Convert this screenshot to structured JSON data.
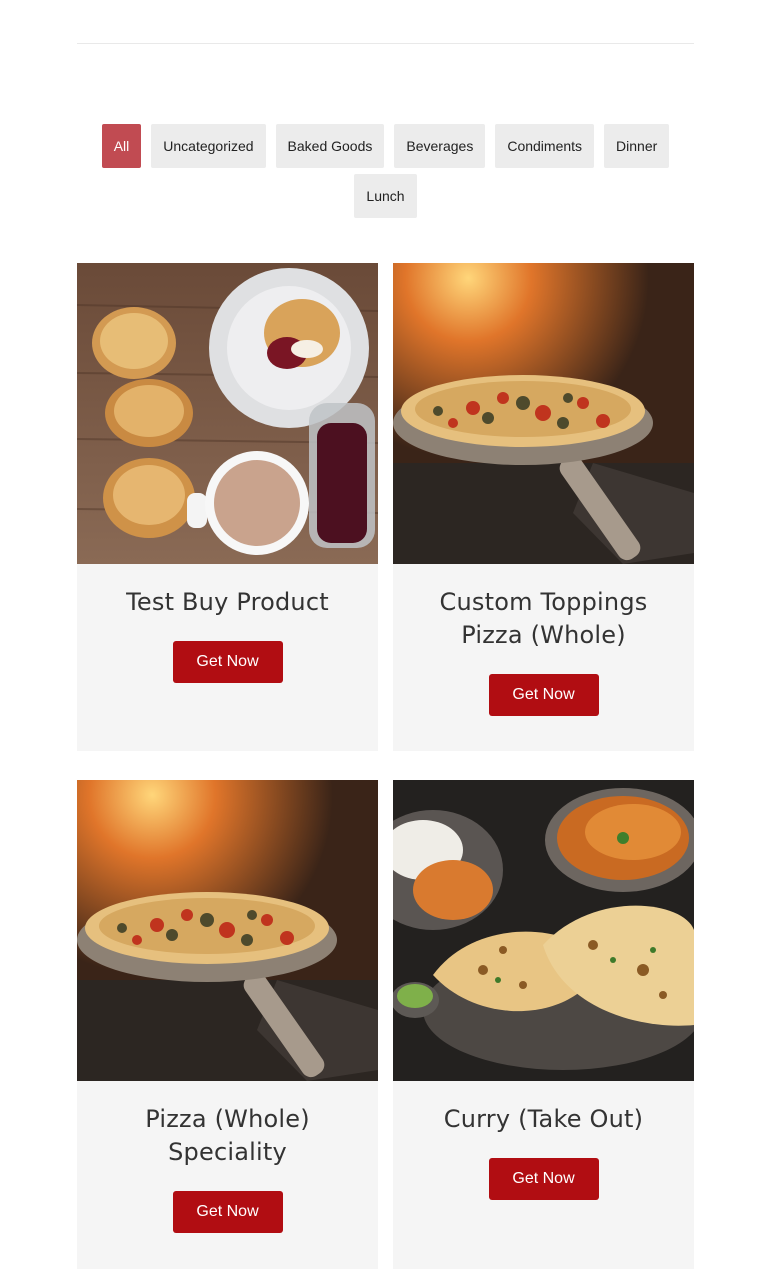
{
  "filters": [
    {
      "label": "All",
      "active": true
    },
    {
      "label": "Uncategorized"
    },
    {
      "label": "Baked Goods"
    },
    {
      "label": "Beverages"
    },
    {
      "label": "Condiments"
    },
    {
      "label": "Dinner"
    },
    {
      "label": "Lunch"
    }
  ],
  "products": [
    {
      "title": "Test Buy Product",
      "button": "Get Now",
      "image": "scones-and-tea-photo"
    },
    {
      "title": "Custom Toppings Pizza (Whole)",
      "button": "Get Now",
      "image": "pizza-on-peel-photo"
    },
    {
      "title": "Pizza (Whole) Speciality",
      "button": "Get Now",
      "image": "pizza-on-peel-photo"
    },
    {
      "title": "Curry (Take Out)",
      "button": "Get Now",
      "image": "curry-and-naan-photo"
    }
  ],
  "colors": {
    "accent": "#b10d12",
    "active_filter": "#c14b52",
    "filter_bg": "#ececec",
    "card_bg": "#f5f5f5"
  }
}
